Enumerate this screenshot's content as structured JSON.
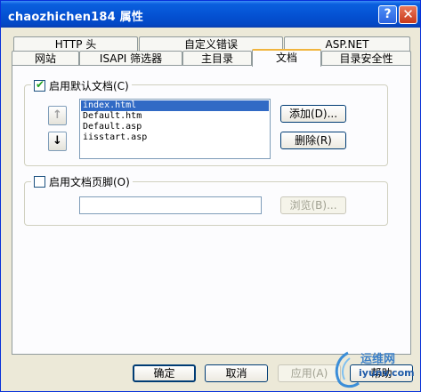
{
  "window": {
    "title": "chaozhichen184 属性",
    "help_glyph": "?",
    "close_glyph": "✕"
  },
  "tabs_row1": [
    {
      "label": "HTTP 头"
    },
    {
      "label": "自定义错误"
    },
    {
      "label": "ASP.NET"
    }
  ],
  "tabs_row2": [
    {
      "label": "网站"
    },
    {
      "label": "ISAPI 筛选器"
    },
    {
      "label": "主目录"
    },
    {
      "label": "文档",
      "active": true
    },
    {
      "label": "目录安全性"
    }
  ],
  "default_doc": {
    "checkbox_label": "启用默认文档(C)",
    "checked": true,
    "up_glyph": "↑",
    "down_glyph": "↓",
    "documents": [
      "index.html",
      "Default.htm",
      "Default.asp",
      "iisstart.asp"
    ],
    "selected_index": 0,
    "add_label": "添加(D)...",
    "remove_label": "删除(R)"
  },
  "footer_doc": {
    "checkbox_label": "启用文档页脚(O)",
    "checked": false,
    "path_value": "",
    "browse_label": "浏览(B)..."
  },
  "bottom_buttons": {
    "ok": "确定",
    "cancel": "取消",
    "apply": "应用(A)",
    "help": "帮助"
  },
  "watermark": {
    "line1": "运维网",
    "line2": "iyunv.com"
  },
  "colors": {
    "titlebar": "#0553d4",
    "selection": "#316ac5",
    "dialog_bg": "#ece9d8",
    "tab_highlight": "#f0b43c"
  }
}
